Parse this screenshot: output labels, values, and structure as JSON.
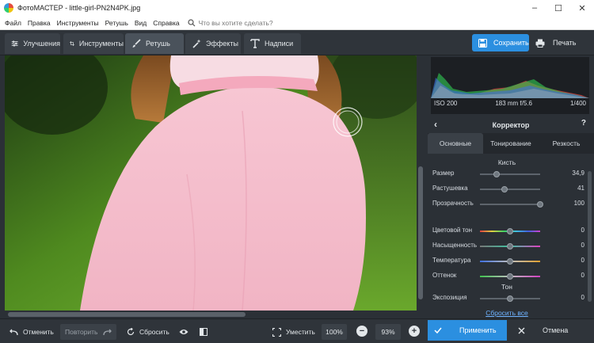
{
  "window": {
    "title": "ФотоМАСТЕР - little-girl-PN2N4PK.jpg",
    "minimize": "–",
    "maximize": "☐",
    "close": "✕"
  },
  "menu": {
    "items": [
      "Файл",
      "Правка",
      "Инструменты",
      "Ретушь",
      "Вид",
      "Справка"
    ],
    "search_placeholder": "Что вы хотите сделать?"
  },
  "toolbar": {
    "tabs": [
      {
        "label": "Улучшения",
        "icon": "sliders-icon"
      },
      {
        "label": "Инструменты",
        "icon": "crop-icon"
      },
      {
        "label": "Ретушь",
        "icon": "brush-icon",
        "active": true
      },
      {
        "label": "Эффекты",
        "icon": "magic-wand-icon"
      },
      {
        "label": "Надписи",
        "icon": "text-icon"
      }
    ],
    "save_label": "Сохранить",
    "print_label": "Печать"
  },
  "histogram": {
    "iso": "ISO 200",
    "lens": "183 mm f/5.6",
    "shutter": "1/400"
  },
  "corrector": {
    "title": "Корректор",
    "help": "?",
    "tabs": [
      "Основные",
      "Тонирование",
      "Резкость"
    ],
    "active_tab": "Основные",
    "brush_section": "Кисть",
    "brush": [
      {
        "label": "Размер",
        "value": "34,9",
        "level": 0.27
      },
      {
        "label": "Растушевка",
        "value": "41",
        "level": 0.41
      },
      {
        "label": "Прозрачность",
        "value": "100",
        "level": 1.0
      }
    ],
    "color": [
      {
        "label": "Цветовой тон",
        "value": "0",
        "level": 0.5
      },
      {
        "label": "Насыщенность",
        "value": "0",
        "level": 0.5
      },
      {
        "label": "Температура",
        "value": "0",
        "level": 0.5
      },
      {
        "label": "Оттенок",
        "value": "0",
        "level": 0.5
      }
    ],
    "tone_section": "Тон",
    "tone": [
      {
        "label": "Экспозиция",
        "value": "0",
        "level": 0.5
      }
    ],
    "reset_all": "Сбросить все"
  },
  "bottom": {
    "undo": "Отменить",
    "redo": "Повторить",
    "reset": "Сбросить",
    "fit": "Уместить",
    "zoom_100": "100%",
    "zoom_current": "93%",
    "apply": "Применить",
    "cancel": "Отмена"
  },
  "colors": {
    "accent": "#2b8fe0",
    "panel": "#2b3036",
    "toolbar": "#2f343a"
  }
}
